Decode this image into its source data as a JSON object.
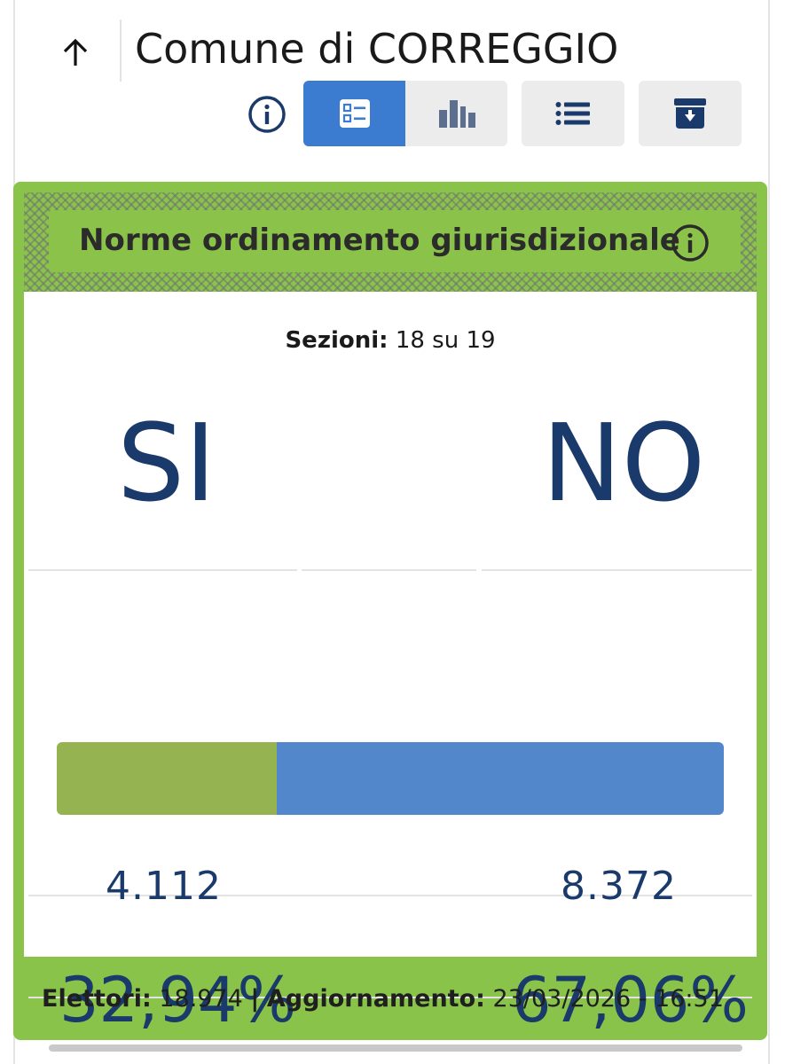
{
  "header": {
    "back_icon": "arrow-up-icon",
    "title": "Comune di CORREGGIO"
  },
  "toolbar": {
    "info_icon": "info-circle-icon",
    "buttons": [
      {
        "icon": "detail-view-icon",
        "active": true
      },
      {
        "icon": "bar-chart-icon",
        "active": false
      },
      {
        "icon": "list-icon",
        "active": false
      },
      {
        "icon": "archive-download-icon",
        "active": false
      }
    ],
    "active_color": "#3b7bd0",
    "inactive_color": "#ececec"
  },
  "card": {
    "title": "Norme ordinamento giurisdizionale",
    "accent_color": "#89c34a",
    "sezioni": {
      "label": "Sezioni:",
      "value": "18 su 19"
    },
    "options": [
      {
        "label": "SI",
        "votes": "4.112",
        "percent": "32,94%",
        "fraction": 0.3294,
        "color": "#95b451"
      },
      {
        "label": "NO",
        "votes": "8.372",
        "percent": "67,06%",
        "fraction": 0.6706,
        "color": "#5387cb"
      }
    ],
    "footer": {
      "elettori_label": "Elettori:",
      "elettori_value": "18.974",
      "separator": "|",
      "aggiornamento_label": "Aggiornamento:",
      "aggiornamento_value": "23/03/2026 - 16:51"
    }
  }
}
